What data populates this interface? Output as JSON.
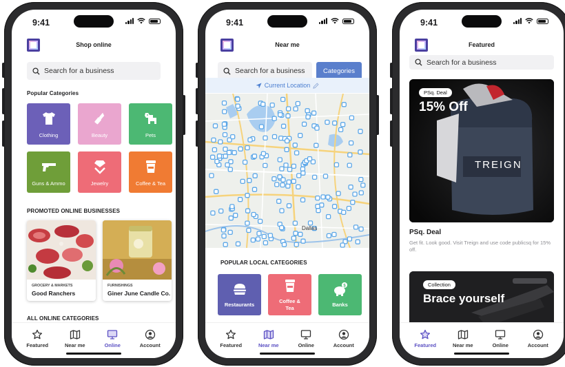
{
  "status": {
    "time": "9:41"
  },
  "phones": [
    {
      "title": "Shop online",
      "search_placeholder": "Search for a business",
      "popular_heading": "Popular Categories",
      "categories": [
        {
          "label": "Clothing",
          "color": "#6c60b8",
          "icon": "tshirt-icon"
        },
        {
          "label": "Beauty",
          "color": "#eaa6cf",
          "icon": "lipstick-icon"
        },
        {
          "label": "Pets",
          "color": "#4cb873",
          "icon": "dog-icon"
        },
        {
          "label": "Guns & Ammo",
          "color": "#6f9e39",
          "icon": "gun-icon"
        },
        {
          "label": "Jewelry",
          "color": "#ee6c77",
          "icon": "diamond-icon"
        },
        {
          "label": "Coffee & Tea",
          "color": "#f07b33",
          "icon": "coffee-cup-icon"
        }
      ],
      "promoted_heading": "PROMOTED ONLINE BUSINESSES",
      "promoted": [
        {
          "category": "GROCERY & MARKETS",
          "name": "Good Ranchers"
        },
        {
          "category": "FURNISHINGS",
          "name": "Giner June Candle Co."
        }
      ],
      "all_heading": "ALL ONLINE CATEGORIES",
      "active_tab": "Online"
    },
    {
      "title": "Near me",
      "search_placeholder": "Search for a business",
      "categories_button": "Categories",
      "current_location": "Current Location",
      "map_labels": [
        "Dallas"
      ],
      "local_heading": "POPULAR LOCAL CATEGORIES",
      "local_categories": [
        {
          "label": "Restaurants",
          "color": "#5f5fb0",
          "icon": "burger-icon"
        },
        {
          "label": "Coffee & Tea",
          "color": "#ee6c77",
          "icon": "coffee-cup-icon"
        },
        {
          "label": "Banks",
          "color": "#4cb873",
          "icon": "piggy-bank-icon"
        }
      ],
      "active_tab": "Near me"
    },
    {
      "title": "Featured",
      "search_placeholder": "Search for a business",
      "deal": {
        "badge": "PSq. Deal",
        "headline": "15% Off",
        "brand": "TREIGN",
        "title": "PSq. Deal",
        "description": "Get fit. Look good. Visit Treign and use code publicsq for 15% off."
      },
      "collection": {
        "badge": "Collection",
        "headline": "Brace yourself"
      },
      "active_tab": "Featured"
    }
  ],
  "tabs": [
    {
      "label": "Featured",
      "icon": "star-icon"
    },
    {
      "label": "Near me",
      "icon": "map-icon"
    },
    {
      "label": "Online",
      "icon": "monitor-icon"
    },
    {
      "label": "Account",
      "icon": "account-icon"
    }
  ],
  "colors": {
    "accent": "#5b50c3",
    "frame": "#2b2b2d",
    "map_pin": "#5aa6e8"
  }
}
